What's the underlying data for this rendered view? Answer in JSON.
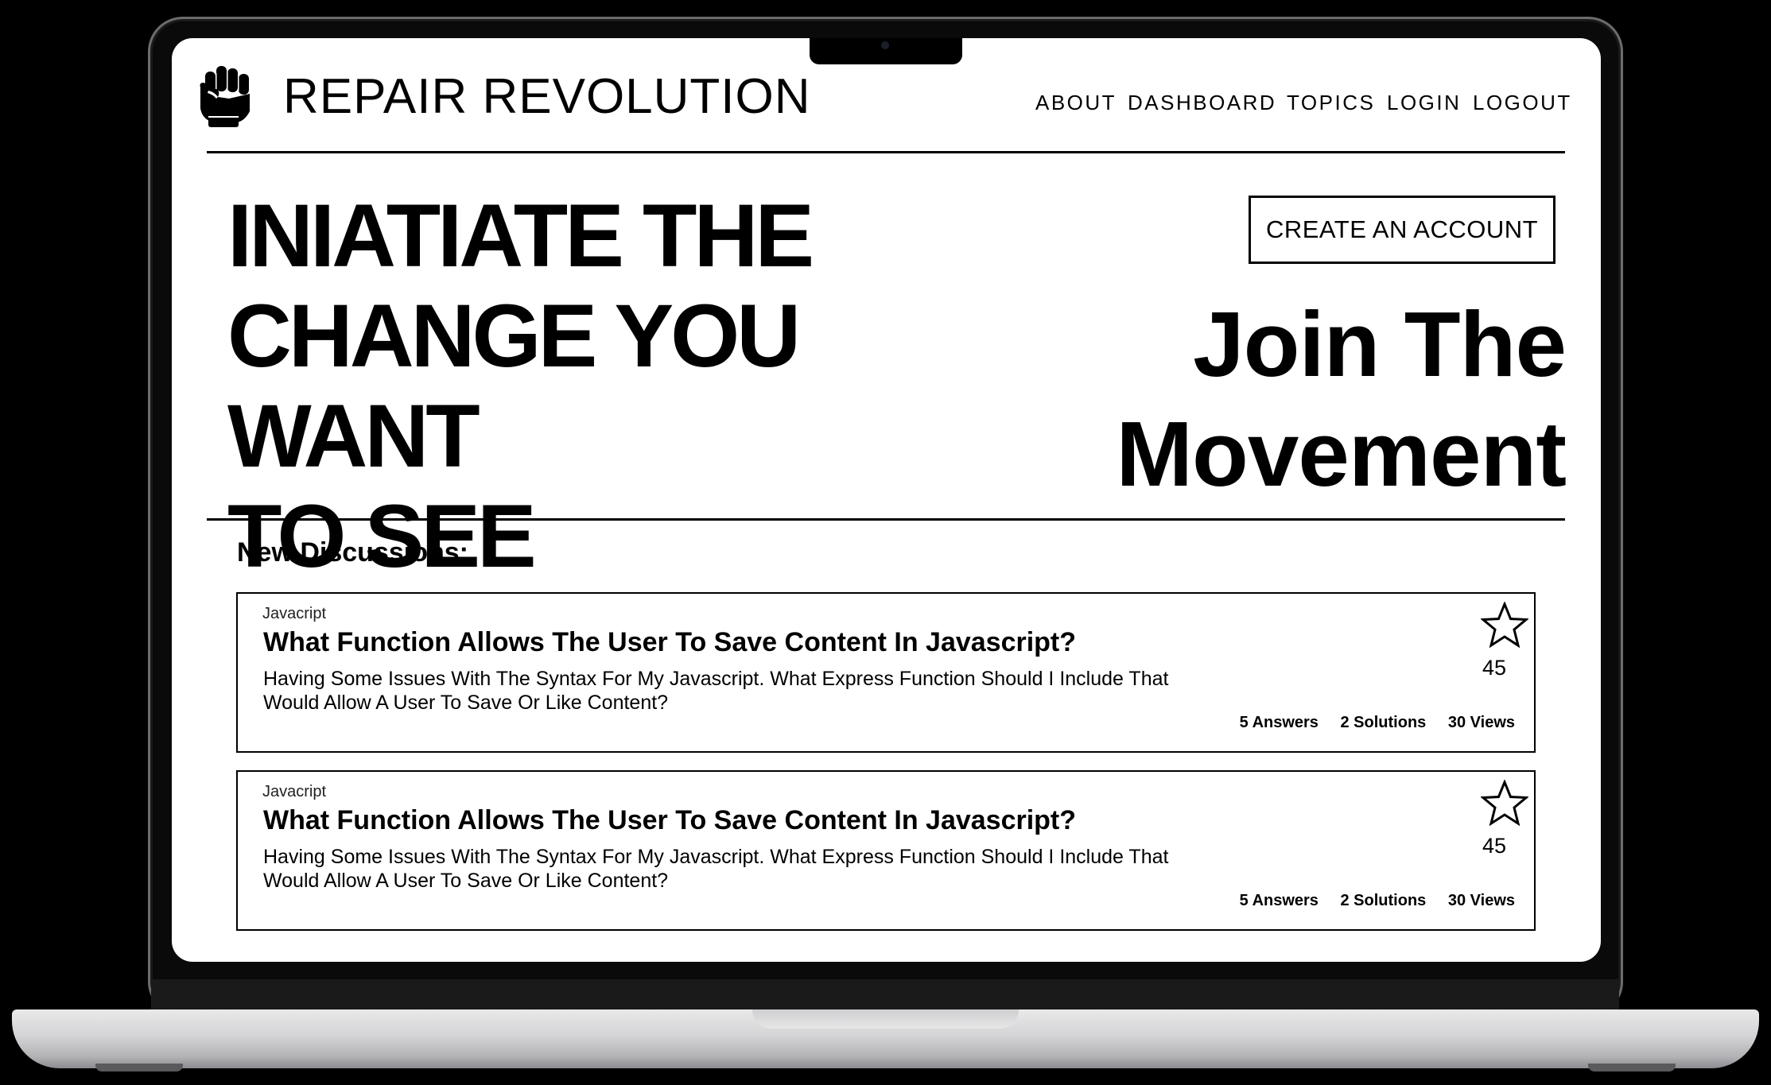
{
  "brand": {
    "name": "REPAIR REVOLUTION",
    "logo_icon": "raised-fist-icon"
  },
  "nav": {
    "items": [
      "ABOUT",
      "DASHBOARD",
      "TOPICS",
      "LOGIN",
      "LOGOUT"
    ]
  },
  "hero": {
    "lines": [
      "INIATIATE THE",
      "CHANGE YOU WANT",
      "TO SEE"
    ],
    "cta_label": "CREATE AN ACCOUNT",
    "join_lines": [
      "Join The",
      "Movement"
    ]
  },
  "discussions": {
    "heading": "New Discussions:",
    "items": [
      {
        "topic": "Javacript",
        "title": "What Function Allows The User To Save Content In Javascript?",
        "body": "Having Some Issues With The Syntax For My Javascript. What Express Function Should I Include That Would Allow A User To Save Or Like Content?",
        "star_icon": "star-outline-icon",
        "stars": "45",
        "answers": "5 Answers",
        "solutions": "2 Solutions",
        "views": "30 Views"
      },
      {
        "topic": "Javacript",
        "title": "What Function Allows The User To Save Content In Javascript?",
        "body": "Having Some Issues With The Syntax For My Javascript. What Express Function Should I Include That Would Allow A User To Save Or Like Content?",
        "star_icon": "star-outline-icon",
        "stars": "45",
        "answers": "5 Answers",
        "solutions": "2 Solutions",
        "views": "30 Views"
      }
    ]
  }
}
